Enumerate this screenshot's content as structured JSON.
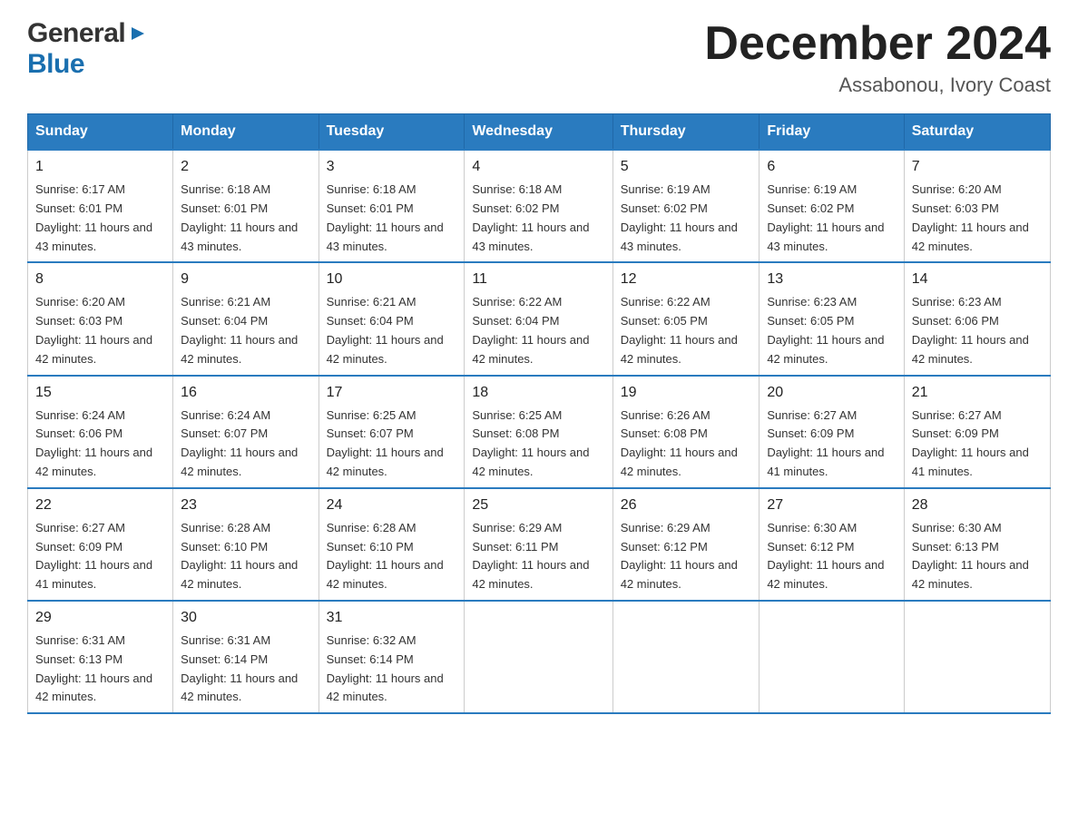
{
  "header": {
    "logo_general": "General",
    "logo_blue": "Blue",
    "month_title": "December 2024",
    "location": "Assabonou, Ivory Coast"
  },
  "calendar": {
    "days_of_week": [
      "Sunday",
      "Monday",
      "Tuesday",
      "Wednesday",
      "Thursday",
      "Friday",
      "Saturday"
    ],
    "weeks": [
      [
        {
          "day": "1",
          "sunrise": "6:17 AM",
          "sunset": "6:01 PM",
          "daylight": "11 hours and 43 minutes."
        },
        {
          "day": "2",
          "sunrise": "6:18 AM",
          "sunset": "6:01 PM",
          "daylight": "11 hours and 43 minutes."
        },
        {
          "day": "3",
          "sunrise": "6:18 AM",
          "sunset": "6:01 PM",
          "daylight": "11 hours and 43 minutes."
        },
        {
          "day": "4",
          "sunrise": "6:18 AM",
          "sunset": "6:02 PM",
          "daylight": "11 hours and 43 minutes."
        },
        {
          "day": "5",
          "sunrise": "6:19 AM",
          "sunset": "6:02 PM",
          "daylight": "11 hours and 43 minutes."
        },
        {
          "day": "6",
          "sunrise": "6:19 AM",
          "sunset": "6:02 PM",
          "daylight": "11 hours and 43 minutes."
        },
        {
          "day": "7",
          "sunrise": "6:20 AM",
          "sunset": "6:03 PM",
          "daylight": "11 hours and 42 minutes."
        }
      ],
      [
        {
          "day": "8",
          "sunrise": "6:20 AM",
          "sunset": "6:03 PM",
          "daylight": "11 hours and 42 minutes."
        },
        {
          "day": "9",
          "sunrise": "6:21 AM",
          "sunset": "6:04 PM",
          "daylight": "11 hours and 42 minutes."
        },
        {
          "day": "10",
          "sunrise": "6:21 AM",
          "sunset": "6:04 PM",
          "daylight": "11 hours and 42 minutes."
        },
        {
          "day": "11",
          "sunrise": "6:22 AM",
          "sunset": "6:04 PM",
          "daylight": "11 hours and 42 minutes."
        },
        {
          "day": "12",
          "sunrise": "6:22 AM",
          "sunset": "6:05 PM",
          "daylight": "11 hours and 42 minutes."
        },
        {
          "day": "13",
          "sunrise": "6:23 AM",
          "sunset": "6:05 PM",
          "daylight": "11 hours and 42 minutes."
        },
        {
          "day": "14",
          "sunrise": "6:23 AM",
          "sunset": "6:06 PM",
          "daylight": "11 hours and 42 minutes."
        }
      ],
      [
        {
          "day": "15",
          "sunrise": "6:24 AM",
          "sunset": "6:06 PM",
          "daylight": "11 hours and 42 minutes."
        },
        {
          "day": "16",
          "sunrise": "6:24 AM",
          "sunset": "6:07 PM",
          "daylight": "11 hours and 42 minutes."
        },
        {
          "day": "17",
          "sunrise": "6:25 AM",
          "sunset": "6:07 PM",
          "daylight": "11 hours and 42 minutes."
        },
        {
          "day": "18",
          "sunrise": "6:25 AM",
          "sunset": "6:08 PM",
          "daylight": "11 hours and 42 minutes."
        },
        {
          "day": "19",
          "sunrise": "6:26 AM",
          "sunset": "6:08 PM",
          "daylight": "11 hours and 42 minutes."
        },
        {
          "day": "20",
          "sunrise": "6:27 AM",
          "sunset": "6:09 PM",
          "daylight": "11 hours and 41 minutes."
        },
        {
          "day": "21",
          "sunrise": "6:27 AM",
          "sunset": "6:09 PM",
          "daylight": "11 hours and 41 minutes."
        }
      ],
      [
        {
          "day": "22",
          "sunrise": "6:27 AM",
          "sunset": "6:09 PM",
          "daylight": "11 hours and 41 minutes."
        },
        {
          "day": "23",
          "sunrise": "6:28 AM",
          "sunset": "6:10 PM",
          "daylight": "11 hours and 42 minutes."
        },
        {
          "day": "24",
          "sunrise": "6:28 AM",
          "sunset": "6:10 PM",
          "daylight": "11 hours and 42 minutes."
        },
        {
          "day": "25",
          "sunrise": "6:29 AM",
          "sunset": "6:11 PM",
          "daylight": "11 hours and 42 minutes."
        },
        {
          "day": "26",
          "sunrise": "6:29 AM",
          "sunset": "6:12 PM",
          "daylight": "11 hours and 42 minutes."
        },
        {
          "day": "27",
          "sunrise": "6:30 AM",
          "sunset": "6:12 PM",
          "daylight": "11 hours and 42 minutes."
        },
        {
          "day": "28",
          "sunrise": "6:30 AM",
          "sunset": "6:13 PM",
          "daylight": "11 hours and 42 minutes."
        }
      ],
      [
        {
          "day": "29",
          "sunrise": "6:31 AM",
          "sunset": "6:13 PM",
          "daylight": "11 hours and 42 minutes."
        },
        {
          "day": "30",
          "sunrise": "6:31 AM",
          "sunset": "6:14 PM",
          "daylight": "11 hours and 42 minutes."
        },
        {
          "day": "31",
          "sunrise": "6:32 AM",
          "sunset": "6:14 PM",
          "daylight": "11 hours and 42 minutes."
        },
        null,
        null,
        null,
        null
      ]
    ]
  }
}
